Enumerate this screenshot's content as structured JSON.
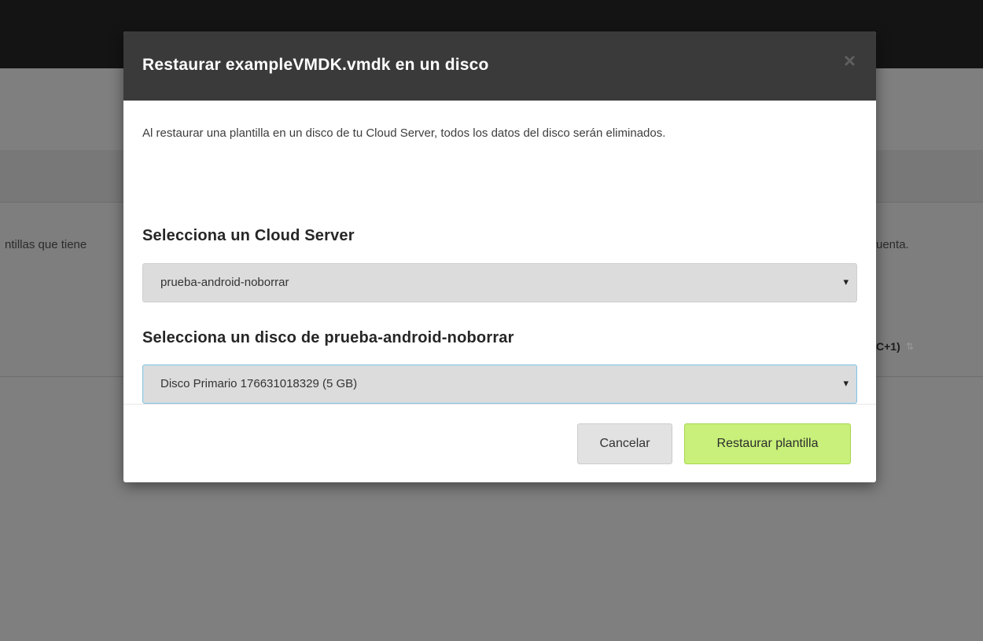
{
  "background": {
    "left_text": "ntillas que tiene",
    "right_text": "uenta.",
    "right_text2": "C+1)",
    "sort_icon": "sort-icon"
  },
  "modal": {
    "title": "Restaurar exampleVMDK.vmdk en un disco",
    "close_label": "×",
    "intro": "Al restaurar una plantilla en un disco de tu Cloud Server, todos los datos del disco serán eliminados.",
    "server_section_title": "Selecciona un Cloud Server",
    "server_select_value": "prueba-android-noborrar",
    "disk_section_title": "Selecciona un disco de prueba-android-noborrar",
    "disk_select_value": "Disco Primario 176631018329 (5 GB)",
    "select_arrow": "▾",
    "cancel_label": "Cancelar",
    "restore_label": "Restaurar plantilla"
  },
  "colors": {
    "header_bg": "#3a3a3a",
    "primary_button": "#c8f07a",
    "overlay": "#808080"
  }
}
